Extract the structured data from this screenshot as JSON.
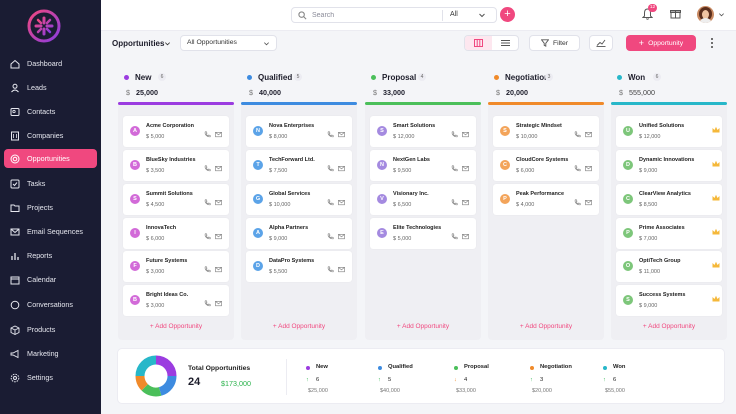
{
  "colors": {
    "accent": "#f0487f",
    "sidebar": "#1a1c33",
    "new": "#9b3ce0",
    "qualified": "#3d8be0",
    "proposal": "#4bbf5a",
    "negotiation": "#f08a2a",
    "won": "#27b7c9"
  },
  "sidebar": {
    "items": [
      {
        "label": "Dashboard",
        "icon": "home-icon"
      },
      {
        "label": "Leads",
        "icon": "user-icon"
      },
      {
        "label": "Contacts",
        "icon": "contact-card-icon"
      },
      {
        "label": "Companies",
        "icon": "building-icon"
      },
      {
        "label": "Opportunities",
        "icon": "target-icon",
        "active": true
      },
      {
        "label": "Tasks",
        "icon": "checkbox-icon"
      },
      {
        "label": "Projects",
        "icon": "folder-icon"
      },
      {
        "label": "Email Sequences",
        "icon": "mail-icon"
      },
      {
        "label": "Reports",
        "icon": "bar-chart-icon"
      },
      {
        "label": "Calendar",
        "icon": "calendar-icon"
      },
      {
        "label": "Conversations",
        "icon": "chat-icon"
      },
      {
        "label": "Products",
        "icon": "box-icon"
      },
      {
        "label": "Marketing",
        "icon": "megaphone-icon"
      },
      {
        "label": "Settings",
        "icon": "gear-icon"
      }
    ]
  },
  "topbar": {
    "search_placeholder": "Search",
    "search_scope": "All",
    "notification_count": "12"
  },
  "toolbar": {
    "title": "Opportunities",
    "filter_select": "All Opportunities",
    "filter_label": "Filter",
    "primary_label": "Opportunity"
  },
  "columns": [
    {
      "name": "New",
      "count": "6",
      "currency": "$",
      "amount": "25,000",
      "add_label": "Add Opportunity",
      "cards": [
        {
          "initial": "A",
          "name": "Acme Corporation",
          "value": "$ 5,000"
        },
        {
          "initial": "B",
          "name": "BlueSky Industries",
          "value": "$ 3,500"
        },
        {
          "initial": "S",
          "name": "Summit Solutions",
          "value": "$ 4,500"
        },
        {
          "initial": "I",
          "name": "InnovaTech",
          "value": "$ 6,000"
        },
        {
          "initial": "F",
          "name": "Future Systems",
          "value": "$ 3,000"
        },
        {
          "initial": "B",
          "name": "Bright Ideas Co.",
          "value": "$ 3,000"
        }
      ]
    },
    {
      "name": "Qualified",
      "count": "5",
      "currency": "$",
      "amount": "40,000",
      "add_label": "Add Opportunity",
      "cards": [
        {
          "initial": "N",
          "name": "Nova Enterprises",
          "value": "$ 8,000"
        },
        {
          "initial": "T",
          "name": "TechForward Ltd.",
          "value": "$ 7,500"
        },
        {
          "initial": "G",
          "name": "Global Services",
          "value": "$ 10,000"
        },
        {
          "initial": "A",
          "name": "Alpha Partners",
          "value": "$ 9,000"
        },
        {
          "initial": "D",
          "name": "DataPro Systems",
          "value": "$ 5,500"
        }
      ]
    },
    {
      "name": "Proposal",
      "count": "4",
      "currency": "$",
      "amount": "33,000",
      "add_label": "Add Opportunity",
      "cards": [
        {
          "initial": "S",
          "name": "Smart Solutions",
          "value": "$ 12,000"
        },
        {
          "initial": "N",
          "name": "NextGen Labs",
          "value": "$ 9,500"
        },
        {
          "initial": "V",
          "name": "Visionary Inc.",
          "value": "$ 6,500"
        },
        {
          "initial": "E",
          "name": "Elite Technologies",
          "value": "$ 5,000"
        }
      ]
    },
    {
      "name": "Negotiation",
      "count": "3",
      "currency": "$",
      "amount": "20,000",
      "add_label": "Add Opportunity",
      "cards": [
        {
          "initial": "S",
          "name": "Strategic Mindset",
          "value": "$ 10,000"
        },
        {
          "initial": "C",
          "name": "CloudCore Systems",
          "value": "$ 6,000"
        },
        {
          "initial": "P",
          "name": "Peak Performance",
          "value": "$ 4,000"
        }
      ]
    },
    {
      "name": "Won",
      "count": "6",
      "currency": "$",
      "amount": "555,000",
      "add_label": "Add Opportunity",
      "cards": [
        {
          "initial": "U",
          "name": "Unified Solutions",
          "value": "$ 12,000"
        },
        {
          "initial": "D",
          "name": "Dynamic Innovations",
          "value": "$ 9,000"
        },
        {
          "initial": "C",
          "name": "ClearView Analytics",
          "value": "$ 8,500"
        },
        {
          "initial": "P",
          "name": "Prime Associates",
          "value": "$ 7,000"
        },
        {
          "initial": "O",
          "name": "OptiTech Group",
          "value": "$ 11,000"
        },
        {
          "initial": "S",
          "name": "Success Systems",
          "value": "$ 9,000"
        }
      ]
    }
  ],
  "summary": {
    "label": "Total Opportunities",
    "count": "24",
    "amount": "$173,000",
    "stats": [
      {
        "name": "New",
        "arrow": "↑",
        "num": "6",
        "amt": "$25,000"
      },
      {
        "name": "Qualified",
        "arrow": "↑",
        "num": "5",
        "amt": "$40,000"
      },
      {
        "name": "Proposal",
        "arrow": "↓",
        "num": "4",
        "amt": "$33,000"
      },
      {
        "name": "Negotiation",
        "arrow": "↑",
        "num": "3",
        "amt": "$20,000"
      },
      {
        "name": "Won",
        "arrow": "↑",
        "num": "6",
        "amt": "$55,000"
      }
    ]
  }
}
